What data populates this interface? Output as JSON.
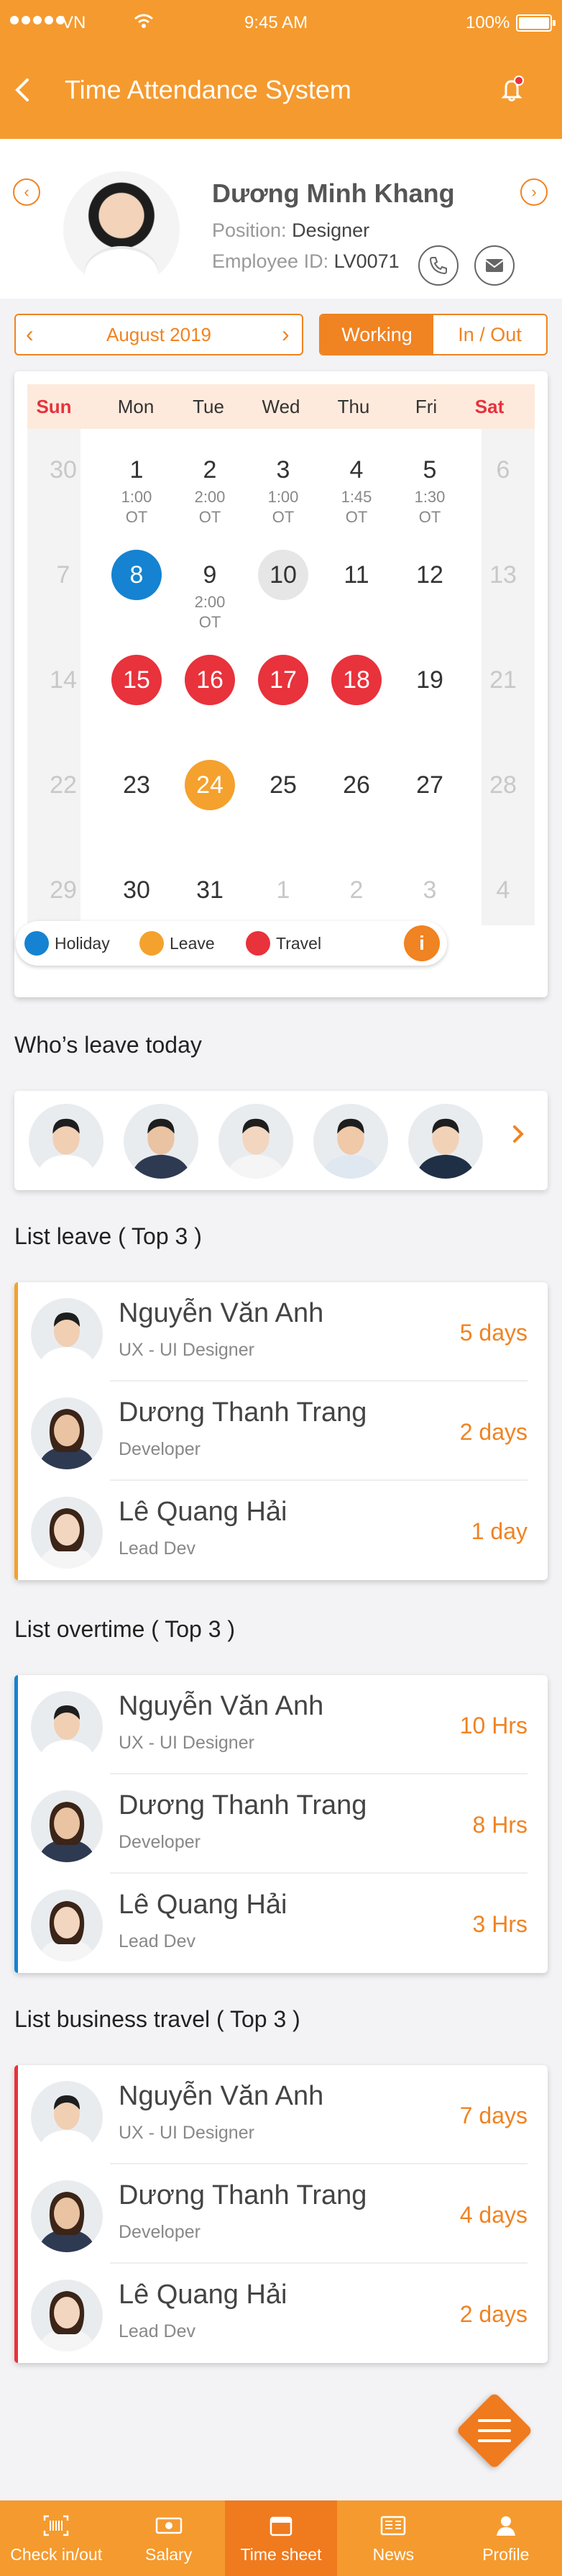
{
  "status": {
    "carrier": "VN",
    "time": "9:45 AM",
    "battery": "100%"
  },
  "header": {
    "title": "Time Attendance System"
  },
  "profile": {
    "name": "Dương Minh Khang",
    "position_label": "Position:",
    "position": "Designer",
    "employee_label": "Employee ID:",
    "employee_id": "LV0071"
  },
  "controls": {
    "month": "August 2019",
    "segments": [
      "Working",
      "In / Out"
    ],
    "active_segment": 0
  },
  "calendar": {
    "weekdays": [
      "Sun",
      "Mon",
      "Tue",
      "Wed",
      "Thu",
      "Fri",
      "Sat"
    ],
    "weeks": [
      [
        {
          "d": "30",
          "m": true
        },
        {
          "d": "1",
          "sub": [
            "1:00",
            "OT"
          ]
        },
        {
          "d": "2",
          "sub": [
            "2:00",
            "OT"
          ]
        },
        {
          "d": "3",
          "sub": [
            "1:00",
            "OT"
          ]
        },
        {
          "d": "4",
          "sub": [
            "1:45",
            "OT"
          ]
        },
        {
          "d": "5",
          "sub": [
            "1:30",
            "OT"
          ]
        },
        {
          "d": "6",
          "m": true
        }
      ],
      [
        {
          "d": "7",
          "m": true
        },
        {
          "d": "8",
          "t": "holiday"
        },
        {
          "d": "9",
          "sub": [
            "2:00",
            "OT"
          ]
        },
        {
          "d": "10",
          "t": "today"
        },
        {
          "d": "11"
        },
        {
          "d": "12"
        },
        {
          "d": "13",
          "m": true
        }
      ],
      [
        {
          "d": "14",
          "m": true
        },
        {
          "d": "15",
          "t": "travel"
        },
        {
          "d": "16",
          "t": "travel"
        },
        {
          "d": "17",
          "t": "travel"
        },
        {
          "d": "18",
          "t": "travel"
        },
        {
          "d": "19"
        },
        {
          "d": "21",
          "m": true
        }
      ],
      [
        {
          "d": "22",
          "m": true
        },
        {
          "d": "23"
        },
        {
          "d": "24",
          "t": "leave"
        },
        {
          "d": "25"
        },
        {
          "d": "26"
        },
        {
          "d": "27"
        },
        {
          "d": "28",
          "m": true
        }
      ],
      [
        {
          "d": "29",
          "m": true
        },
        {
          "d": "30"
        },
        {
          "d": "31"
        },
        {
          "d": "1",
          "m": true
        },
        {
          "d": "2",
          "m": true
        },
        {
          "d": "3",
          "m": true
        },
        {
          "d": "4",
          "m": true
        }
      ]
    ],
    "legend": {
      "holiday": "Holiday",
      "leave": "Leave",
      "travel": "Travel",
      "info": "i"
    }
  },
  "colors": {
    "primary": "#f59a2e",
    "accent": "#f08322",
    "holiday": "#1583d1",
    "leave": "#f4a12e",
    "travel": "#e8323c",
    "weekend": "#e8323c"
  },
  "who_leave": {
    "title": "Who’s leave today",
    "avatar_count": 5
  },
  "lists": [
    {
      "title": "List leave ( Top 3 )",
      "bar_color": "#f4a12e",
      "rows": [
        {
          "name": "Nguyễn Văn Anh",
          "role": "UX - UI Designer",
          "value": "5 days"
        },
        {
          "name": "Dương Thanh Trang",
          "role": "Developer",
          "value": "2 days"
        },
        {
          "name": "Lê Quang Hải",
          "role": "Lead Dev",
          "value": "1 day"
        }
      ]
    },
    {
      "title": "List overtime ( Top 3 )",
      "bar_color": "#1583d1",
      "rows": [
        {
          "name": "Nguyễn Văn Anh",
          "role": "UX - UI Designer",
          "value": "10 Hrs"
        },
        {
          "name": "Dương Thanh Trang",
          "role": "Developer",
          "value": "8 Hrs"
        },
        {
          "name": "Lê Quang Hải",
          "role": "Lead Dev",
          "value": "3 Hrs"
        }
      ]
    },
    {
      "title": "List business travel ( Top 3 )",
      "bar_color": "#e8323c",
      "rows": [
        {
          "name": "Nguyễn Văn Anh",
          "role": "UX - UI Designer",
          "value": "7 days"
        },
        {
          "name": "Dương Thanh Trang",
          "role": "Developer",
          "value": "4 days"
        },
        {
          "name": "Lê Quang Hải",
          "role": "Lead Dev",
          "value": "2 days"
        }
      ]
    }
  ],
  "tabbar": {
    "items": [
      {
        "label": "Check in/out",
        "icon": "barcode-icon"
      },
      {
        "label": "Salary",
        "icon": "money-icon"
      },
      {
        "label": "Time sheet",
        "icon": "calendar-icon"
      },
      {
        "label": "News",
        "icon": "news-icon"
      },
      {
        "label": "Profile",
        "icon": "user-icon"
      }
    ],
    "active": 2
  }
}
